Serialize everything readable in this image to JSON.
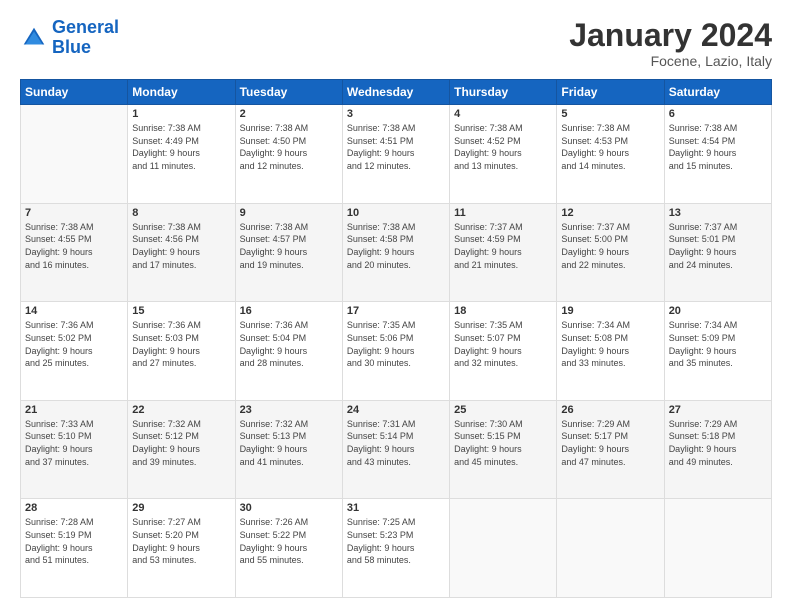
{
  "logo": {
    "line1": "General",
    "line2": "Blue"
  },
  "header": {
    "month_year": "January 2024",
    "location": "Focene, Lazio, Italy"
  },
  "days_of_week": [
    "Sunday",
    "Monday",
    "Tuesday",
    "Wednesday",
    "Thursday",
    "Friday",
    "Saturday"
  ],
  "weeks": [
    [
      {
        "day": "",
        "info": ""
      },
      {
        "day": "1",
        "info": "Sunrise: 7:38 AM\nSunset: 4:49 PM\nDaylight: 9 hours\nand 11 minutes."
      },
      {
        "day": "2",
        "info": "Sunrise: 7:38 AM\nSunset: 4:50 PM\nDaylight: 9 hours\nand 12 minutes."
      },
      {
        "day": "3",
        "info": "Sunrise: 7:38 AM\nSunset: 4:51 PM\nDaylight: 9 hours\nand 12 minutes."
      },
      {
        "day": "4",
        "info": "Sunrise: 7:38 AM\nSunset: 4:52 PM\nDaylight: 9 hours\nand 13 minutes."
      },
      {
        "day": "5",
        "info": "Sunrise: 7:38 AM\nSunset: 4:53 PM\nDaylight: 9 hours\nand 14 minutes."
      },
      {
        "day": "6",
        "info": "Sunrise: 7:38 AM\nSunset: 4:54 PM\nDaylight: 9 hours\nand 15 minutes."
      }
    ],
    [
      {
        "day": "7",
        "info": "Sunrise: 7:38 AM\nSunset: 4:55 PM\nDaylight: 9 hours\nand 16 minutes."
      },
      {
        "day": "8",
        "info": "Sunrise: 7:38 AM\nSunset: 4:56 PM\nDaylight: 9 hours\nand 17 minutes."
      },
      {
        "day": "9",
        "info": "Sunrise: 7:38 AM\nSunset: 4:57 PM\nDaylight: 9 hours\nand 19 minutes."
      },
      {
        "day": "10",
        "info": "Sunrise: 7:38 AM\nSunset: 4:58 PM\nDaylight: 9 hours\nand 20 minutes."
      },
      {
        "day": "11",
        "info": "Sunrise: 7:37 AM\nSunset: 4:59 PM\nDaylight: 9 hours\nand 21 minutes."
      },
      {
        "day": "12",
        "info": "Sunrise: 7:37 AM\nSunset: 5:00 PM\nDaylight: 9 hours\nand 22 minutes."
      },
      {
        "day": "13",
        "info": "Sunrise: 7:37 AM\nSunset: 5:01 PM\nDaylight: 9 hours\nand 24 minutes."
      }
    ],
    [
      {
        "day": "14",
        "info": "Sunrise: 7:36 AM\nSunset: 5:02 PM\nDaylight: 9 hours\nand 25 minutes."
      },
      {
        "day": "15",
        "info": "Sunrise: 7:36 AM\nSunset: 5:03 PM\nDaylight: 9 hours\nand 27 minutes."
      },
      {
        "day": "16",
        "info": "Sunrise: 7:36 AM\nSunset: 5:04 PM\nDaylight: 9 hours\nand 28 minutes."
      },
      {
        "day": "17",
        "info": "Sunrise: 7:35 AM\nSunset: 5:06 PM\nDaylight: 9 hours\nand 30 minutes."
      },
      {
        "day": "18",
        "info": "Sunrise: 7:35 AM\nSunset: 5:07 PM\nDaylight: 9 hours\nand 32 minutes."
      },
      {
        "day": "19",
        "info": "Sunrise: 7:34 AM\nSunset: 5:08 PM\nDaylight: 9 hours\nand 33 minutes."
      },
      {
        "day": "20",
        "info": "Sunrise: 7:34 AM\nSunset: 5:09 PM\nDaylight: 9 hours\nand 35 minutes."
      }
    ],
    [
      {
        "day": "21",
        "info": "Sunrise: 7:33 AM\nSunset: 5:10 PM\nDaylight: 9 hours\nand 37 minutes."
      },
      {
        "day": "22",
        "info": "Sunrise: 7:32 AM\nSunset: 5:12 PM\nDaylight: 9 hours\nand 39 minutes."
      },
      {
        "day": "23",
        "info": "Sunrise: 7:32 AM\nSunset: 5:13 PM\nDaylight: 9 hours\nand 41 minutes."
      },
      {
        "day": "24",
        "info": "Sunrise: 7:31 AM\nSunset: 5:14 PM\nDaylight: 9 hours\nand 43 minutes."
      },
      {
        "day": "25",
        "info": "Sunrise: 7:30 AM\nSunset: 5:15 PM\nDaylight: 9 hours\nand 45 minutes."
      },
      {
        "day": "26",
        "info": "Sunrise: 7:29 AM\nSunset: 5:17 PM\nDaylight: 9 hours\nand 47 minutes."
      },
      {
        "day": "27",
        "info": "Sunrise: 7:29 AM\nSunset: 5:18 PM\nDaylight: 9 hours\nand 49 minutes."
      }
    ],
    [
      {
        "day": "28",
        "info": "Sunrise: 7:28 AM\nSunset: 5:19 PM\nDaylight: 9 hours\nand 51 minutes."
      },
      {
        "day": "29",
        "info": "Sunrise: 7:27 AM\nSunset: 5:20 PM\nDaylight: 9 hours\nand 53 minutes."
      },
      {
        "day": "30",
        "info": "Sunrise: 7:26 AM\nSunset: 5:22 PM\nDaylight: 9 hours\nand 55 minutes."
      },
      {
        "day": "31",
        "info": "Sunrise: 7:25 AM\nSunset: 5:23 PM\nDaylight: 9 hours\nand 58 minutes."
      },
      {
        "day": "",
        "info": ""
      },
      {
        "day": "",
        "info": ""
      },
      {
        "day": "",
        "info": ""
      }
    ]
  ]
}
